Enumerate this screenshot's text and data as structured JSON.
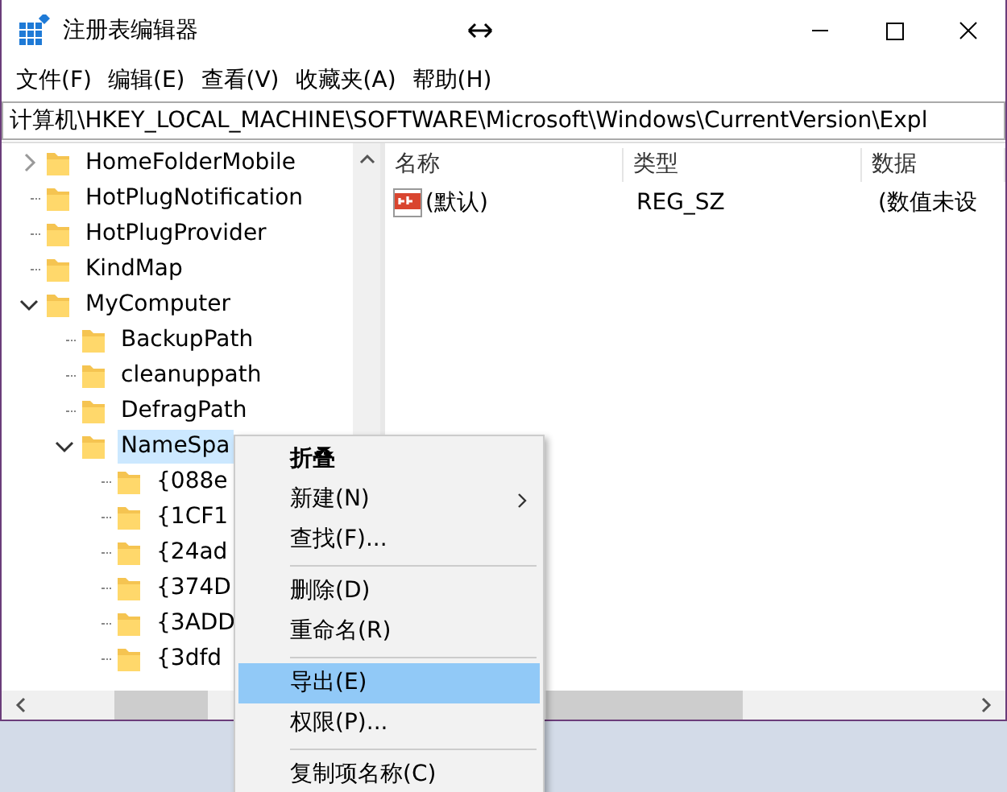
{
  "window": {
    "title": "注册表编辑器"
  },
  "menu_bar": [
    "文件(F)",
    "编辑(E)",
    "查看(V)",
    "收藏夹(A)",
    "帮助(H)"
  ],
  "address": "计算机\\HKEY_LOCAL_MACHINE\\SOFTWARE\\Microsoft\\Windows\\CurrentVersion\\Expl",
  "tree": [
    {
      "label": "HomeFolderMobile",
      "expanded": false,
      "selected": false
    },
    {
      "label": "HotPlugNotification",
      "selected": false
    },
    {
      "label": "HotPlugProvider",
      "selected": false
    },
    {
      "label": "KindMap",
      "selected": false
    },
    {
      "label": "MyComputer",
      "expanded": true,
      "selected": false,
      "children": [
        {
          "label": "BackupPath",
          "selected": false
        },
        {
          "label": "cleanuppath",
          "selected": false
        },
        {
          "label": "DefragPath",
          "selected": false
        },
        {
          "label": "NameSpa",
          "expanded": true,
          "selected": true,
          "children": [
            {
              "label": "{088e",
              "selected": false
            },
            {
              "label": "{1CF1",
              "selected": false
            },
            {
              "label": "{24ad",
              "selected": false
            },
            {
              "label": "{374D",
              "selected": false
            },
            {
              "label": "{3ADD",
              "selected": false
            },
            {
              "label": "{3dfd",
              "selected": false
            }
          ]
        }
      ]
    }
  ],
  "table": {
    "columns": [
      "名称",
      "类型",
      "数据"
    ],
    "rows": [
      {
        "name": "(默认)",
        "type": "REG_SZ",
        "data": "(数值未设"
      }
    ]
  },
  "context_menu": [
    {
      "kind": "item",
      "label": "折叠",
      "bold": true,
      "submenu": false,
      "selected": false
    },
    {
      "kind": "item",
      "label": "新建(N)",
      "bold": false,
      "submenu": true,
      "selected": false
    },
    {
      "kind": "item",
      "label": "查找(F)...",
      "bold": false,
      "submenu": false,
      "selected": false
    },
    {
      "kind": "separator"
    },
    {
      "kind": "item",
      "label": "删除(D)",
      "bold": false,
      "submenu": false,
      "selected": false
    },
    {
      "kind": "item",
      "label": "重命名(R)",
      "bold": false,
      "submenu": false,
      "selected": false
    },
    {
      "kind": "separator"
    },
    {
      "kind": "item",
      "label": "导出(E)",
      "bold": false,
      "submenu": false,
      "selected": true
    },
    {
      "kind": "item",
      "label": "权限(P)...",
      "bold": false,
      "submenu": false,
      "selected": false
    },
    {
      "kind": "separator"
    },
    {
      "kind": "item",
      "label": "复制项名称(C)",
      "bold": false,
      "submenu": false,
      "selected": false
    }
  ]
}
